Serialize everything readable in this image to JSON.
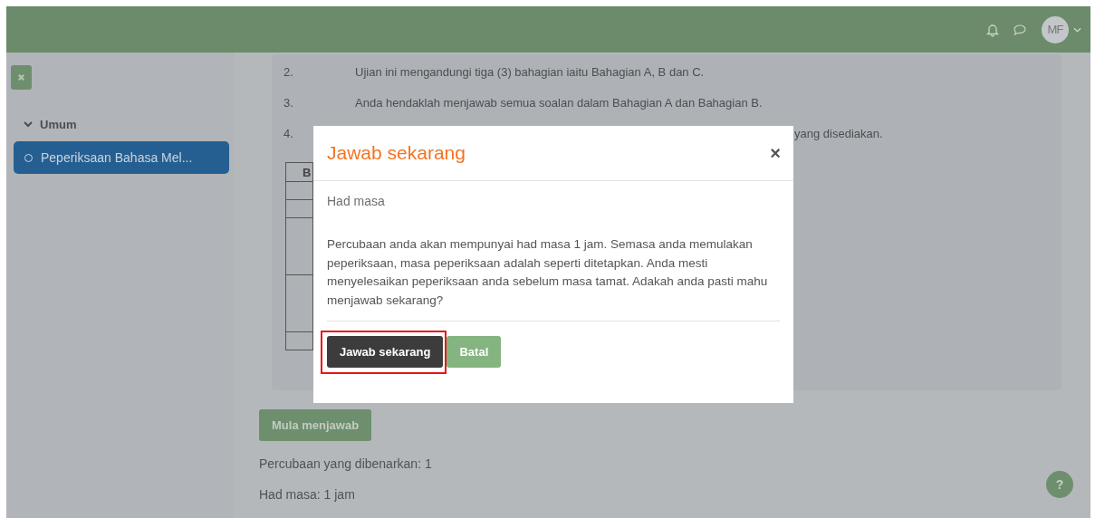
{
  "navbar": {
    "user_initials": "MF"
  },
  "sidebar": {
    "sections": [
      {
        "label": "Umum",
        "expanded": true,
        "items": [
          {
            "label": "Peperiksaan Bahasa Mel...",
            "selected": true
          }
        ]
      }
    ]
  },
  "instructions": [
    {
      "number": "2.",
      "text": "Ujian ini mengandungi tiga (3) bahagian iaitu Bahagian A, B dan C."
    },
    {
      "number": "3.",
      "text": "Anda hendaklah menjawab semua soalan dalam Bahagian A dan Bahagian B."
    },
    {
      "number": "4.",
      "text": "yang disediakan."
    }
  ],
  "table": {
    "column_1": "B"
  },
  "start_button": "Mula menjawab",
  "attempts_text": "Percubaan yang dibenarkan: 1",
  "time_limit_text": "Had masa: 1 jam",
  "help": "?",
  "modal": {
    "title": "Jawab sekarang",
    "close": "×",
    "subtitle": "Had masa",
    "message": "Percubaan anda akan mempunyai had masa 1 jam. Semasa anda memulakan peperiksaan, masa peperiksaan adalah seperti ditetapkan. Anda mesti menyelesaikan peperiksaan anda sebelum masa tamat. Adakah anda pasti mahu menjawab sekarang?",
    "buttons": [
      {
        "label": "Jawab sekarang",
        "kind": "primary",
        "highlighted": true
      },
      {
        "label": "Batal",
        "kind": "secondary",
        "highlighted": false
      }
    ]
  }
}
